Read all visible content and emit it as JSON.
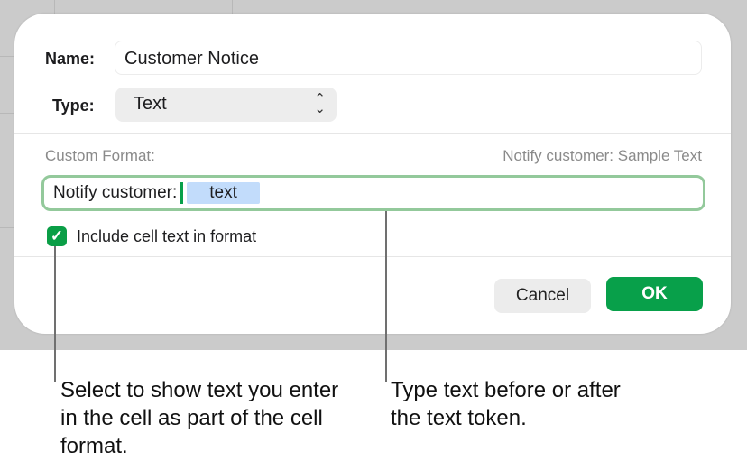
{
  "dialog": {
    "name_label": "Name:",
    "name_value": "Customer Notice",
    "type_label": "Type:",
    "type_value": "Text",
    "custom_format_label": "Custom Format:",
    "preview": "Notify customer: Sample Text",
    "format_prefix": "Notify customer:",
    "format_token": "text",
    "include_checkbox_label": "Include cell text in format",
    "include_checked": true,
    "cancel_label": "Cancel",
    "ok_label": "OK"
  },
  "callouts": {
    "checkbox": "Select to show text you enter in the cell as part of the cell format.",
    "token": "Type text before or after the text token."
  },
  "colors": {
    "accent": "#08a04a",
    "token": "#c2dcfb",
    "focus_ring": "#93c99b"
  }
}
